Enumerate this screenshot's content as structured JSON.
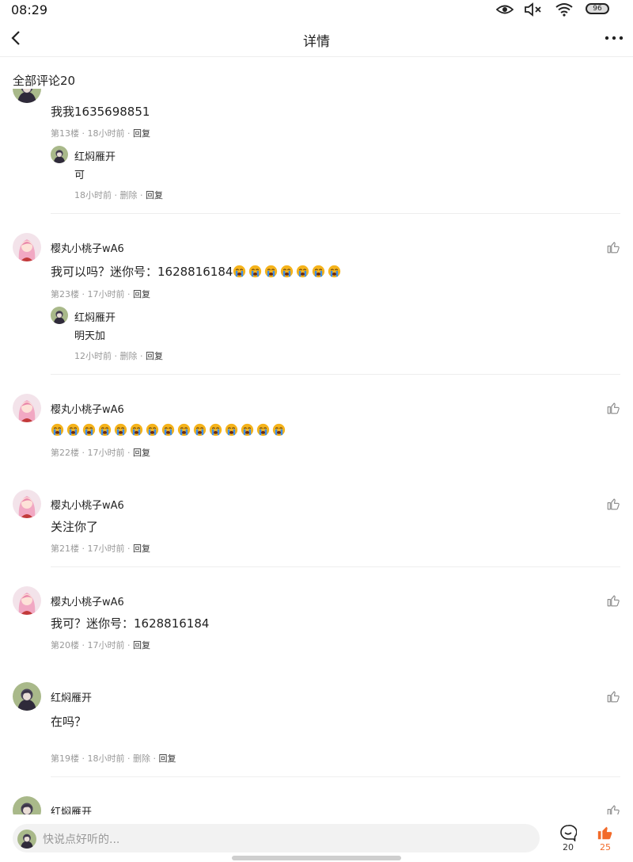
{
  "status_bar": {
    "time": "08:29",
    "battery": "96"
  },
  "header": {
    "title": "详情"
  },
  "comments_section": {
    "title": "全部评论20"
  },
  "comments": [
    {
      "content": "我我1635698851",
      "floor": "第13楼",
      "time": "18小时前",
      "reply": "回复",
      "sub_reply": {
        "username": "红焖雁开",
        "content": "可",
        "time": "18小时前",
        "delete": "删除",
        "reply": "回复"
      }
    },
    {
      "username": "樱丸小桃子wA6",
      "content": "我可以吗？迷你号：1628816184",
      "emoji_count": 7,
      "floor": "第23楼",
      "time": "17小时前",
      "reply": "回复",
      "sub_reply": {
        "username": "红焖雁开",
        "content": "明天加",
        "time": "12小时前",
        "delete": "删除",
        "reply": "回复"
      }
    },
    {
      "username": "樱丸小桃子wA6",
      "content": "",
      "emoji_count": 15,
      "floor": "第22楼",
      "time": "17小时前",
      "reply": "回复"
    },
    {
      "username": "樱丸小桃子wA6",
      "content": "关注你了",
      "floor": "第21楼",
      "time": "17小时前",
      "reply": "回复"
    },
    {
      "username": "樱丸小桃子wA6",
      "content": "我可？迷你号：1628816184",
      "floor": "第20楼",
      "time": "17小时前",
      "reply": "回复"
    },
    {
      "username": "红焖雁开",
      "content": "在吗？",
      "floor": "第19楼",
      "time": "18小时前",
      "delete": "删除",
      "reply": "回复"
    },
    {
      "username": "红焖雁开"
    }
  ],
  "bottom_bar": {
    "placeholder": "快说点好听的...",
    "comment_count": "20",
    "like_count": "25"
  },
  "colors": {
    "accent": "#f26b2a",
    "divider": "#eeeeee",
    "meta": "#999999"
  },
  "icons": [
    "eye-icon",
    "mute-icon",
    "wifi-icon",
    "battery-icon",
    "back-icon",
    "more-icon",
    "thumb-up-icon",
    "comment-icon",
    "cry-emoji"
  ]
}
